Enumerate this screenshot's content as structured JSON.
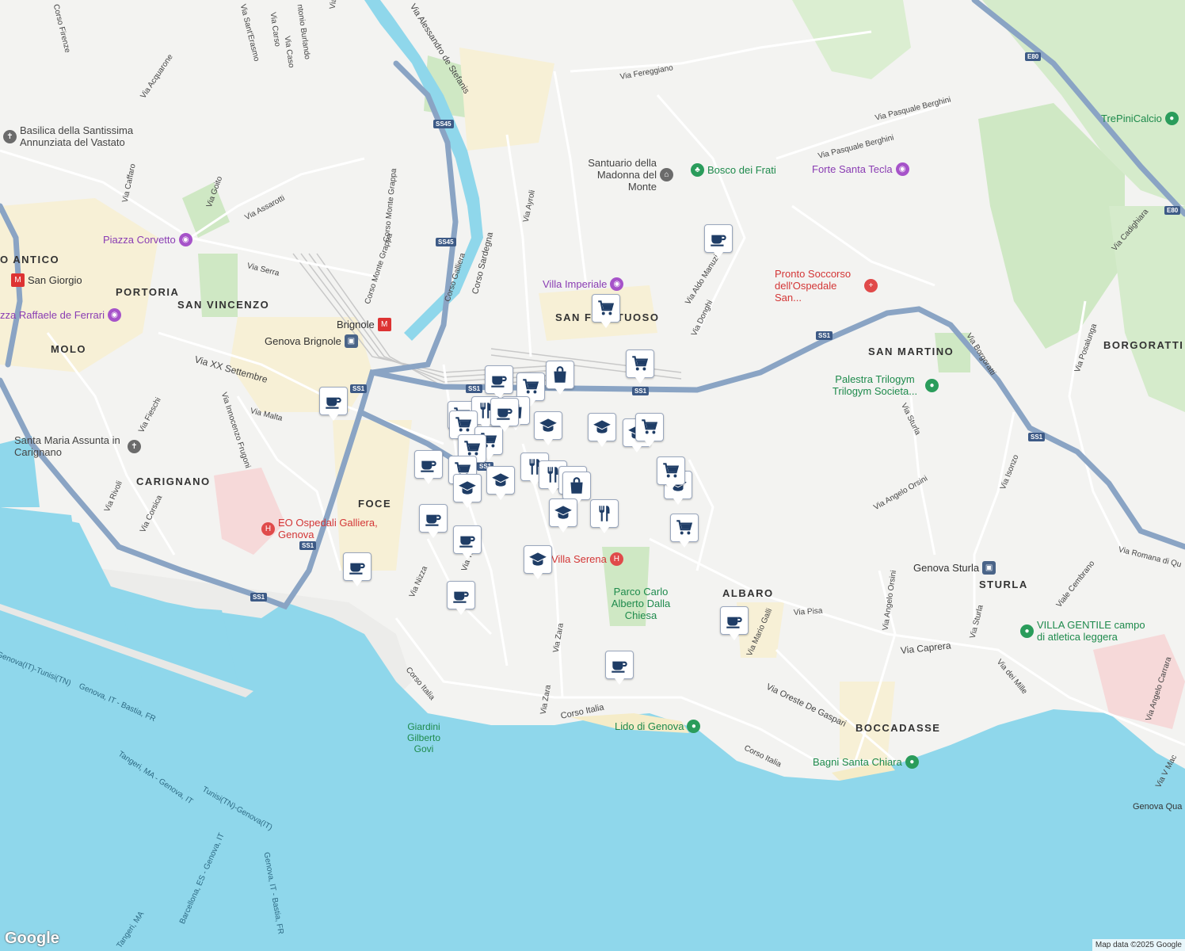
{
  "colors": {
    "sea": "#8fd7eb",
    "land": "#f3f3f1",
    "park": "#cfe8c4",
    "road": "#ffffff",
    "highway": "#8aa4c4",
    "urban": "#f7f0d6",
    "marker_icon": "#1f3d66",
    "marker_border": "#9aa7bd"
  },
  "areas": {
    "portoria": "PORTORIA",
    "san_vincenzo": "SAN VINCENZO",
    "molo": "MOLO",
    "carignano": "CARIGNANO",
    "foce": "FOCE",
    "san_fruttuoso": "SAN FRUTTUOSO",
    "san_martino": "SAN MARTINO",
    "borgoratti": "BORGORATTI",
    "albaro": "ALBARO",
    "sturla": "STURLA",
    "boccadasse": "BOCCADASSE",
    "centro_antico": "O ANTICO"
  },
  "streets": {
    "via_serra": "Via Serra",
    "via_assarotti": "Via Assarotti",
    "via_xx": "Via XX Settembre",
    "via_malta": "Via Malta",
    "via_fieschi": "Via Fieschi",
    "via_frugoni": "Via Innocenzo Frugoni",
    "via_rivoli": "Via Rivoli",
    "via_corsica": "Via Corsica",
    "corso_sardegna": "Corso Sardegna",
    "corso_galliera": "Corso Galliera",
    "via_ayroli": "Via Ayroli",
    "via_fereggiano": "Via Fereggiano",
    "via_berghini1": "Via Pasquale Berghini",
    "via_berghini2": "Via Pasquale Berghini",
    "via_manuzio": "Via Aldo Manuzio",
    "via_donghi": "Via Donghi",
    "via_borgoratti": "Via Borgoratti",
    "via_posalunga": "Via Posalunga",
    "via_cadighiara": "Via Cadighiara",
    "via_sturla": "Via Sturla",
    "via_orsini": "Via Angelo Orsini",
    "via_orsini2": "Via Angelo Orsini",
    "via_isonzo": "Via Isonzo",
    "via_romana": "Via Romana di Qu",
    "viale_cembrano": "Viale Cembrano",
    "via_sturla2": "Via Sturla",
    "via_caprera": "Via Caprera",
    "via_dei_mille": "Via dei Mille",
    "via_carrara": "Via Angelo Carrara",
    "via_pisa": "Via Pisa",
    "via_galli": "Via Mario Galli",
    "via_degasperi": "Via Oreste De Gaspari",
    "corso_italia1": "Corso Italia",
    "corso_italia2": "Corso Italia",
    "corso_italia3": "Corso Italia",
    "via_zara1": "Via Zara",
    "via_zara2": "Via Zara",
    "via_nizza": "Via Nizza",
    "via_trento": "Via Trento",
    "corso_monte_grappa": "Corso Monte Grappa",
    "corso_monte_grappa2": "Corso Monte Grappa",
    "via_acquarone": "Via Acquarone",
    "via_caffaro": "Via Caffaro",
    "via_goito": "Via Goito",
    "corso_firenze": "Corso Firenze",
    "via_carso": "Via Carso",
    "via_caso": "Via Caso",
    "via_burlando": "ntonio Burlando",
    "via_santerasmo": "Via Sant'Erasmo",
    "via_de_stefanis": "Via Alessandro de Stefanis",
    "via_v_mac": "Via V Mac",
    "via_l": "Via L"
  },
  "pois": {
    "basilica": "Basilica della Santissima Annunziata del Vastato",
    "piazza_corvetto": "Piazza Corvetto",
    "san_giorgio": "San Giorgio",
    "piazza_ferrari": "zza Raffaele de Ferrari",
    "santa_maria": "Santa Maria Assunta in Carignano",
    "brignole_metro": "Brignole",
    "genova_brignole": "Genova Brignole",
    "galliera": "EO Ospedali Galliera, Genova",
    "villa_imperiale": "Villa Imperiale",
    "santuario": "Santuario della Madonna del Monte",
    "bosco_frati": "Bosco dei Frati",
    "forte_tecla": "Forte Santa Tecla",
    "pronto_soccorso": "Pronto Soccorso dell'Ospedale San...",
    "trepini": "TrePiniCalcio",
    "palestra": "Palestra Trilogym Trilogym Societa...",
    "villa_serena": "Villa Serena",
    "parco": "Parco Carlo Alberto Dalla Chiesa",
    "genova_sturla": "Genova Sturla",
    "villa_gentile": "VILLA GENTILE campo di atletica leggera",
    "lido": "Lido di Genova",
    "bagni": "Bagni Santa Chiara",
    "giardini": "Giardini Gilberto Govi",
    "genova_qua": "Genova Qua"
  },
  "sea_routes": {
    "r1": "Genova(IT)-Tunisi(TN)",
    "r2": "Genova, IT - Bastia, FR",
    "r3": "Tangeri, MA - Genova, IT",
    "r4": "Tunisi(TN)-Genova(IT)",
    "r5": "Barcellona, ES - Genova, IT",
    "r6": "Tangeri, MA",
    "r7": "Genova, IT - Bastia, FR"
  },
  "shields": {
    "ss1_a": "SS1",
    "ss1_b": "SS1",
    "ss1_c": "SS1",
    "ss1_d": "SS1",
    "ss1_e": "SS1",
    "ss1_f": "SS1",
    "ss1_g": "SS1",
    "ss45_a": "SS45",
    "ss45_b": "SS45",
    "e80_a": "E80",
    "e80_b": "E80",
    "ss1_h": "SS1"
  },
  "markers": [
    {
      "icon": "coffee"
    },
    {
      "icon": "cart"
    },
    {
      "icon": "cart"
    },
    {
      "icon": "coffee"
    },
    {
      "icon": "cart"
    },
    {
      "icon": "bag"
    },
    {
      "icon": "coffee"
    },
    {
      "icon": "cart"
    },
    {
      "icon": "fork"
    },
    {
      "icon": "bag"
    },
    {
      "icon": "cart"
    },
    {
      "icon": "cart"
    },
    {
      "icon": "cart"
    },
    {
      "icon": "coffee"
    },
    {
      "icon": "cart"
    },
    {
      "icon": "grad"
    },
    {
      "icon": "grad"
    },
    {
      "icon": "grad"
    },
    {
      "icon": "grad"
    },
    {
      "icon": "grad"
    },
    {
      "icon": "cart"
    },
    {
      "icon": "grad"
    },
    {
      "icon": "fork"
    },
    {
      "icon": "fork"
    },
    {
      "icon": "fork"
    },
    {
      "icon": "bag"
    },
    {
      "icon": "fork"
    },
    {
      "icon": "grad"
    },
    {
      "icon": "cart"
    },
    {
      "icon": "coffee"
    },
    {
      "icon": "coffee"
    },
    {
      "icon": "grad"
    },
    {
      "icon": "coffee"
    },
    {
      "icon": "coffee"
    },
    {
      "icon": "coffee"
    },
    {
      "icon": "coffee"
    },
    {
      "icon": "coffee"
    },
    {
      "icon": "cart"
    }
  ],
  "branding": {
    "logo": "Google",
    "attribution": "Map data ©2025 Google"
  }
}
